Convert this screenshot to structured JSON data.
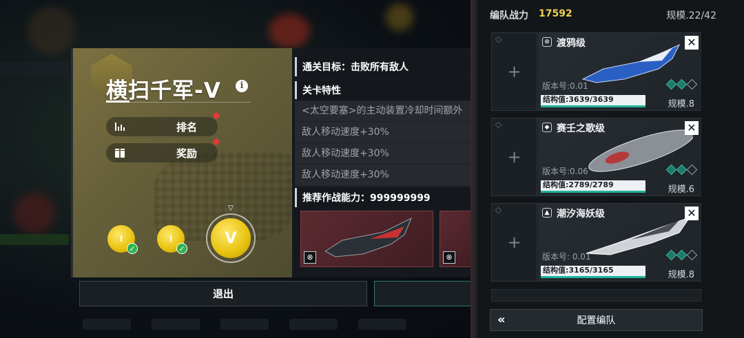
{
  "stage": {
    "title": "横扫千军-Ⅴ",
    "info_glyph": "i",
    "rank_label": "排名",
    "reward_label": "奖励",
    "coins": [
      {
        "roman": "Ⅰ",
        "cleared": true
      },
      {
        "roman": "Ⅰ",
        "cleared": true
      },
      {
        "roman": "Ⅴ",
        "cleared": false
      }
    ],
    "goal_label": "通关目标：击败所有敌人",
    "features_header": "关卡特性",
    "features": [
      "<太空要塞>的主动装置冷却时间额外",
      "敌人移动速度+30%",
      "敌人移动速度+30%",
      "敌人移动速度+30%"
    ],
    "recommend_label": "推荐作战能力：999999999",
    "exit_label": "退出"
  },
  "fleet": {
    "power_label": "编队战力",
    "power_value": "17592",
    "scale_label": "规模.22/42",
    "ships": [
      {
        "name": "渡鸦级",
        "icon": "⊗",
        "version": "版本号:0.01",
        "hp": "结构值:3639/3639",
        "hp_ratio": 1.0,
        "scale": "规模.8",
        "diamonds": [
          true,
          true,
          false
        ],
        "color": "#2a5fc4"
      },
      {
        "name": "赛壬之歌级",
        "icon": "◆",
        "version": "版本号:0.06",
        "hp": "结构值:2789/2789",
        "hp_ratio": 1.0,
        "scale": "规模.6",
        "diamonds": [
          true,
          true,
          false
        ],
        "color": "#8b9097"
      },
      {
        "name": "潮汐海妖级",
        "icon": "▲",
        "version": "版本号: 0.01",
        "hp": "结构值:3165/3165",
        "hp_ratio": 1.0,
        "scale": "规模.8",
        "diamonds": [
          true,
          true,
          false
        ],
        "color": "#cfd3d7"
      }
    ],
    "config_label": "配置编队",
    "back_glyph": "«"
  },
  "colors": {
    "accent_gold": "#f0cf56",
    "hp_green": "#22b39a",
    "popup_gold": "#7c7040",
    "alert_red": "#e23a3a"
  }
}
